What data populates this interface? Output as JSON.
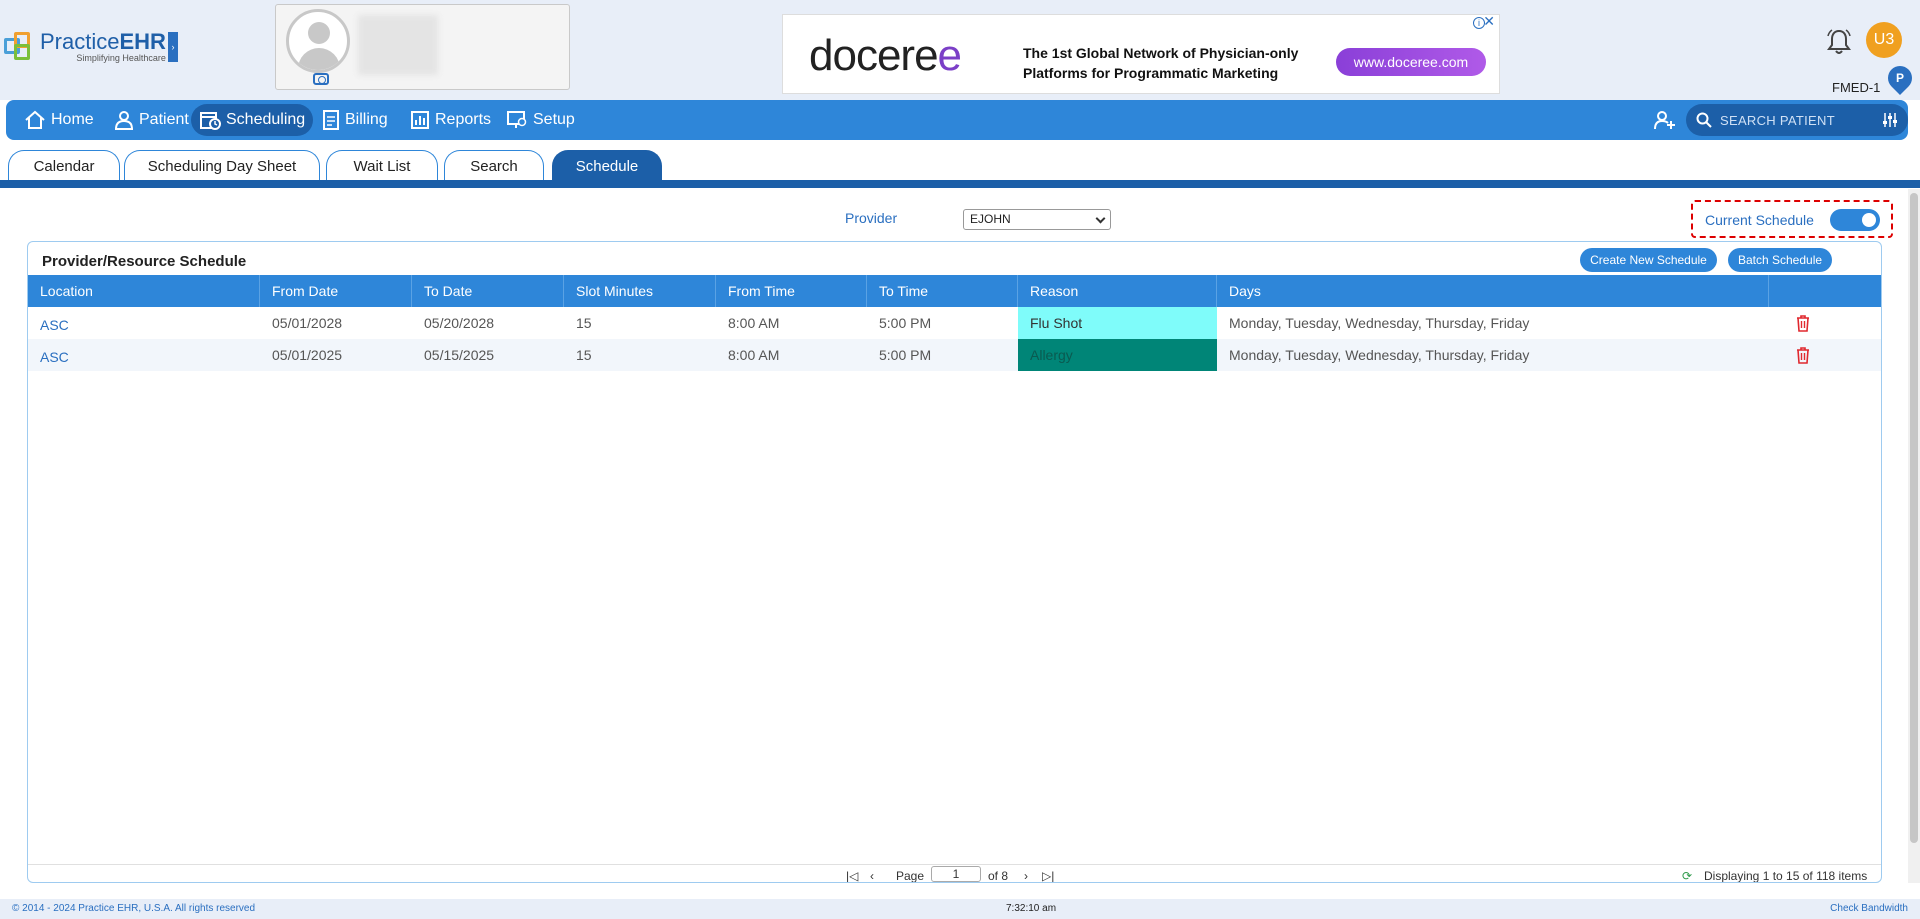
{
  "header": {
    "logo_name_light": "Practice",
    "logo_name_bold": "EHR",
    "logo_tagline": "Simplifying Healthcare",
    "ad": {
      "brand_main": "docere",
      "brand_accent": "e",
      "text_line1": "The 1st Global Network of Physician-only",
      "text_line2": "Platforms for Programmatic Marketing",
      "button_label": "www.doceree.com",
      "close": "✕",
      "info": "i"
    },
    "user_initials": "U3",
    "facility": "FMED-1",
    "pin_label": "P"
  },
  "nav": {
    "items": [
      {
        "label": "Home",
        "icon": "home-icon"
      },
      {
        "label": "Patient",
        "icon": "user-icon"
      },
      {
        "label": "Scheduling",
        "icon": "calendar-clock-icon",
        "active": true
      },
      {
        "label": "Billing",
        "icon": "document-icon"
      },
      {
        "label": "Reports",
        "icon": "bar-chart-icon"
      },
      {
        "label": "Setup",
        "icon": "monitor-gear-icon"
      }
    ],
    "search_placeholder": "SEARCH PATIENT"
  },
  "tabs": [
    {
      "label": "Calendar"
    },
    {
      "label": "Scheduling Day Sheet"
    },
    {
      "label": "Wait List"
    },
    {
      "label": "Search"
    },
    {
      "label": "Schedule",
      "active": true
    }
  ],
  "filters": {
    "provider_label": "Provider",
    "provider_value": "EJOHN",
    "current_schedule_label": "Current Schedule",
    "current_schedule_on": true
  },
  "panel": {
    "title": "Provider/Resource Schedule",
    "create_button": "Create New Schedule",
    "batch_button": "Batch Schedule",
    "columns": [
      "Location",
      "From Date",
      "To Date",
      "Slot Minutes",
      "From Time",
      "To Time",
      "Reason",
      "Days"
    ],
    "rows": [
      {
        "location": "ASC",
        "from_date": "05/01/2028",
        "to_date": "05/20/2028",
        "slot": "15",
        "from_time": "8:00 AM",
        "to_time": "5:00 PM",
        "reason": "Flu Shot",
        "reason_color": "#7ffcfa",
        "days": "Monday, Tuesday, Wednesday, Thursday, Friday"
      },
      {
        "location": "ASC",
        "from_date": "05/01/2025",
        "to_date": "05/15/2025",
        "slot": "15",
        "from_time": "8:00 AM",
        "to_time": "5:00 PM",
        "reason": "Allergy",
        "reason_color": "#008577",
        "days": "Monday, Tuesday, Wednesday, Thursday, Friday"
      }
    ],
    "pager": {
      "page_label": "Page",
      "page_value": "1",
      "of_label": "of 8",
      "summary": "Displaying 1 to 15 of 118 items"
    }
  },
  "footer": {
    "copyright": "© 2014 - 2024 Practice EHR, U.S.A. All rights reserved",
    "time": "7:32:10 am",
    "bandwidth": "Check Bandwidth"
  },
  "colors": {
    "primary": "#2e86d9",
    "primary_dark": "#1c5fa8",
    "delete_red": "#e0282e",
    "highlight_dashed": "#dd0000"
  }
}
